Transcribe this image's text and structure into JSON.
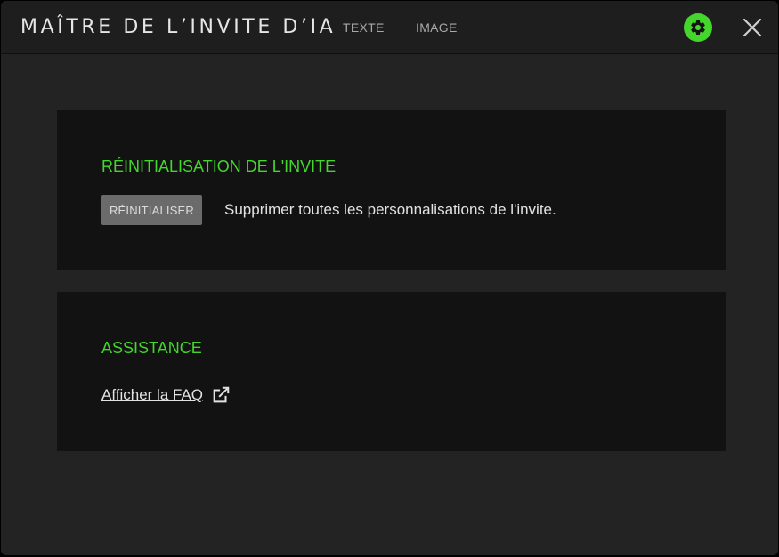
{
  "app": {
    "title": "MAÎTRE DE L’INVITE D’IA",
    "tabs": [
      {
        "label": "TEXTE"
      },
      {
        "label": "IMAGE"
      }
    ],
    "settings_icon": "gear-icon",
    "close_icon": "close-icon",
    "accent_color": "#44d62c"
  },
  "reset_section": {
    "title": "RÉINITIALISATION DE L'INVITE",
    "button_label": "RÉINITIALISER",
    "description": "Supprimer toutes les personnalisations de l'invite."
  },
  "support_section": {
    "title": "ASSISTANCE",
    "faq_link": "Afficher la FAQ",
    "link_icon": "external-link-icon"
  }
}
